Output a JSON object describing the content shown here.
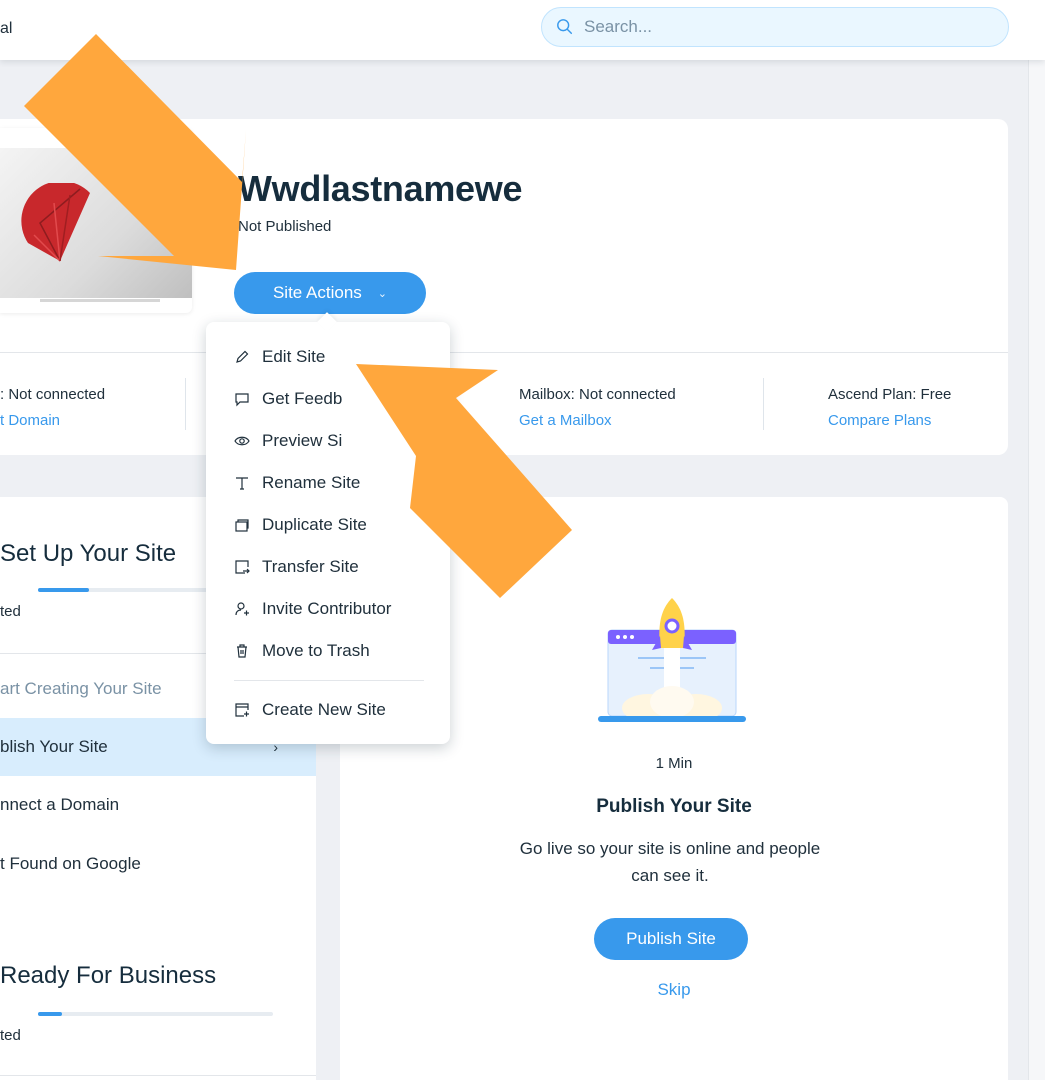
{
  "topbar": {
    "crumb": "al",
    "search_placeholder": "Search..."
  },
  "site": {
    "title": "Wwdlastnamewe",
    "status": "Not Published",
    "actions_label": "Site Actions"
  },
  "info": {
    "domain_label": ": Not connected",
    "domain_link": "t Domain",
    "mailbox_label": "Mailbox: Not connected",
    "mailbox_link": "Get a Mailbox",
    "plan_label": "Ascend Plan: Free",
    "plan_link": "Compare Plans"
  },
  "menu": {
    "items": [
      {
        "label": "Edit Site",
        "icon": "pencil-icon"
      },
      {
        "label": "Get Feedb",
        "icon": "comment-icon"
      },
      {
        "label": "Preview Si",
        "icon": "eye-icon"
      },
      {
        "label": "Rename Site",
        "icon": "text-icon"
      },
      {
        "label": "Duplicate Site",
        "icon": "duplicate-icon"
      },
      {
        "label": "Transfer Site",
        "icon": "transfer-icon"
      },
      {
        "label": "Invite Contributor",
        "icon": "add-user-icon"
      },
      {
        "label": "Move to Trash",
        "icon": "trash-icon"
      }
    ],
    "create_label": "Create New Site",
    "create_icon": "create-site-icon"
  },
  "checklist": {
    "section1_title": "Set Up Your Site",
    "section1_status": "ted",
    "section1_progress": 0.3,
    "steps": [
      {
        "label": "art Creating Your Site",
        "state": "done"
      },
      {
        "label": "blish Your Site",
        "state": "active"
      },
      {
        "label": "nnect a Domain",
        "state": "todo"
      },
      {
        "label": "t Found on Google",
        "state": "todo"
      }
    ],
    "section2_title": "Ready For Business",
    "section2_status": "ted",
    "section2_progress": 0.1
  },
  "publish": {
    "duration": "1 Min",
    "title": "Publish Your Site",
    "description": "Go live so your site is online and people can see it.",
    "button_label": "Publish Site",
    "skip_label": "Skip"
  },
  "colors": {
    "accent": "#3899ec",
    "annotation_arrow": "#ffa73d",
    "active_row": "#d8edfd"
  }
}
